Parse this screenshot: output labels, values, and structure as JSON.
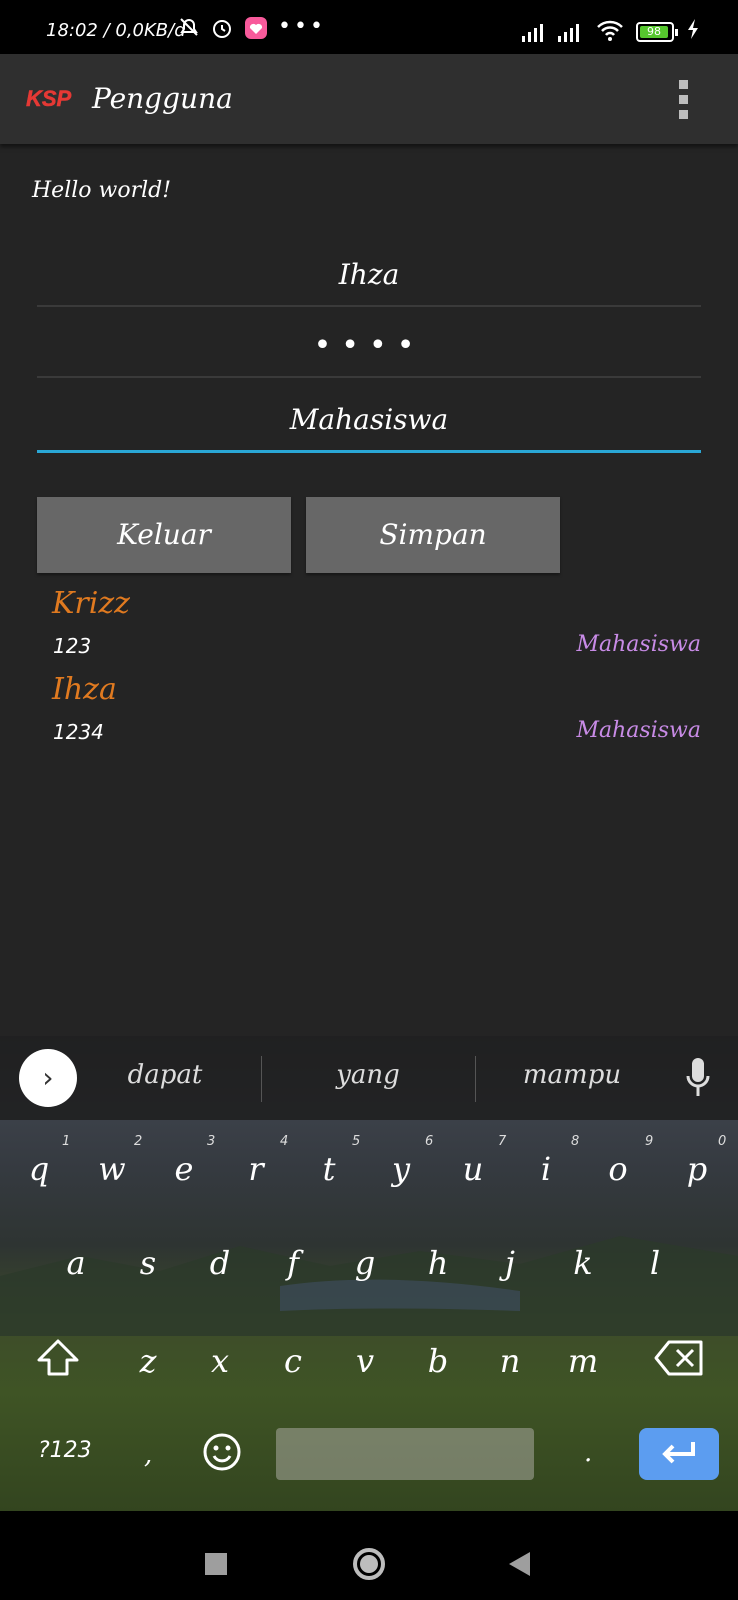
{
  "status": {
    "time": "18:02 / 0,0KB/d",
    "battery": "98"
  },
  "appbar": {
    "title": "Pengguna",
    "logo_text": "KSP"
  },
  "form": {
    "hello": "Hello world!",
    "username": "Ihza",
    "password_mask": "••••",
    "role": "Mahasiswa",
    "btn_keluar": "Keluar",
    "btn_simpan": "Simpan"
  },
  "list": [
    {
      "name": "Krizz",
      "password": "123",
      "role": "Mahasiswa"
    },
    {
      "name": "Ihza",
      "password": "1234",
      "role": "Mahasiswa"
    }
  ],
  "keyboard": {
    "suggestions": [
      "dapat",
      "yang",
      "mampu"
    ],
    "row1": [
      "q",
      "w",
      "e",
      "r",
      "t",
      "y",
      "u",
      "i",
      "o",
      "p"
    ],
    "row1_hints": [
      "1",
      "2",
      "3",
      "4",
      "5",
      "6",
      "7",
      "8",
      "9",
      "0"
    ],
    "row2": [
      "a",
      "s",
      "d",
      "f",
      "g",
      "h",
      "j",
      "k",
      "l"
    ],
    "row3": [
      "z",
      "x",
      "c",
      "v",
      "b",
      "n",
      "m"
    ],
    "sym": "?123",
    "comma": ",",
    "period": "."
  },
  "colors": {
    "accent": "#2aa7d6",
    "name": "#e07a20",
    "role": "#c88be6",
    "enter": "#5c9df0",
    "logo": "#e53935"
  }
}
